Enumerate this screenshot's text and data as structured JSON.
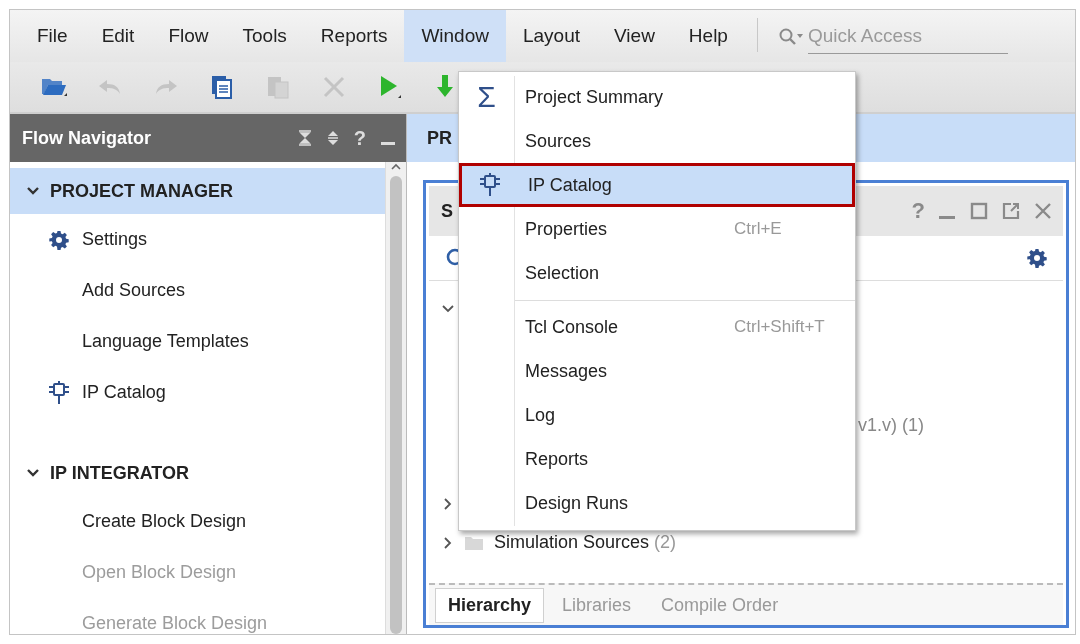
{
  "menubar": {
    "items": [
      {
        "label": "File",
        "selected": false
      },
      {
        "label": "Edit",
        "selected": false
      },
      {
        "label": "Flow",
        "selected": false
      },
      {
        "label": "Tools",
        "selected": false
      },
      {
        "label": "Reports",
        "selected": false
      },
      {
        "label": "Window",
        "selected": true
      },
      {
        "label": "Layout",
        "selected": false
      },
      {
        "label": "View",
        "selected": false
      },
      {
        "label": "Help",
        "selected": false
      }
    ],
    "quick_access": {
      "placeholder": "Quick Access"
    }
  },
  "toolbar": {
    "buttons": [
      {
        "kind": "open",
        "disabled": false
      },
      {
        "kind": "undo",
        "disabled": true
      },
      {
        "kind": "redo",
        "disabled": true
      },
      {
        "kind": "copy",
        "disabled": false
      },
      {
        "kind": "paste",
        "disabled": true
      },
      {
        "kind": "delete",
        "disabled": true
      },
      {
        "kind": "run",
        "disabled": false
      },
      {
        "kind": "download",
        "disabled": false
      }
    ]
  },
  "flow_navigator": {
    "title": "Flow Navigator",
    "help": "?",
    "sections": [
      {
        "label": "PROJECT MANAGER",
        "expanded": true,
        "selected": true,
        "children": [
          {
            "label": "Settings",
            "kind": "gear",
            "disabled": false
          },
          {
            "label": "Add Sources",
            "kind": "plain",
            "disabled": false
          },
          {
            "label": "Language Templates",
            "kind": "plain",
            "disabled": false
          },
          {
            "label": "IP Catalog",
            "kind": "chip",
            "disabled": false
          }
        ]
      },
      {
        "label": "IP INTEGRATOR",
        "expanded": true,
        "selected": false,
        "children": [
          {
            "label": "Create Block Design",
            "kind": "plain",
            "disabled": false
          },
          {
            "label": "Open Block Design",
            "kind": "plain",
            "disabled": true
          },
          {
            "label": "Generate Block Design",
            "kind": "plain",
            "disabled": true
          }
        ]
      }
    ]
  },
  "main": {
    "header": "PR",
    "sources": {
      "title": "S",
      "help": "?",
      "tree": [
        {
          "expanded": true,
          "children": [
            {
              "label": "v1.v) (1)"
            }
          ]
        },
        {
          "expanded": false
        },
        {
          "label": "Simulation Sources",
          "count": "(2)",
          "expanded": false
        }
      ],
      "tabs": [
        {
          "label": "Hierarchy",
          "selected": true
        },
        {
          "label": "Libraries",
          "selected": false
        },
        {
          "label": "Compile Order",
          "selected": false
        }
      ]
    }
  },
  "window_menu": {
    "items": [
      {
        "kind": "item",
        "label": "Project Summary",
        "icon": "Σ",
        "selected": false
      },
      {
        "kind": "item",
        "label": "Sources",
        "selected": false
      },
      {
        "kind": "chip",
        "label": "IP Catalog",
        "selected": true
      },
      {
        "kind": "item",
        "label": "Properties",
        "shortcut": "Ctrl+E",
        "selected": false
      },
      {
        "kind": "item",
        "label": "Selection",
        "selected": false
      },
      {
        "kind": "separator"
      },
      {
        "kind": "item",
        "label": "Tcl Console",
        "shortcut": "Ctrl+Shift+T",
        "selected": false
      },
      {
        "kind": "item",
        "label": "Messages",
        "selected": false
      },
      {
        "kind": "item",
        "label": "Log",
        "selected": false
      },
      {
        "kind": "item",
        "label": "Reports",
        "selected": false
      },
      {
        "kind": "item",
        "label": "Design Runs",
        "selected": false
      }
    ]
  }
}
